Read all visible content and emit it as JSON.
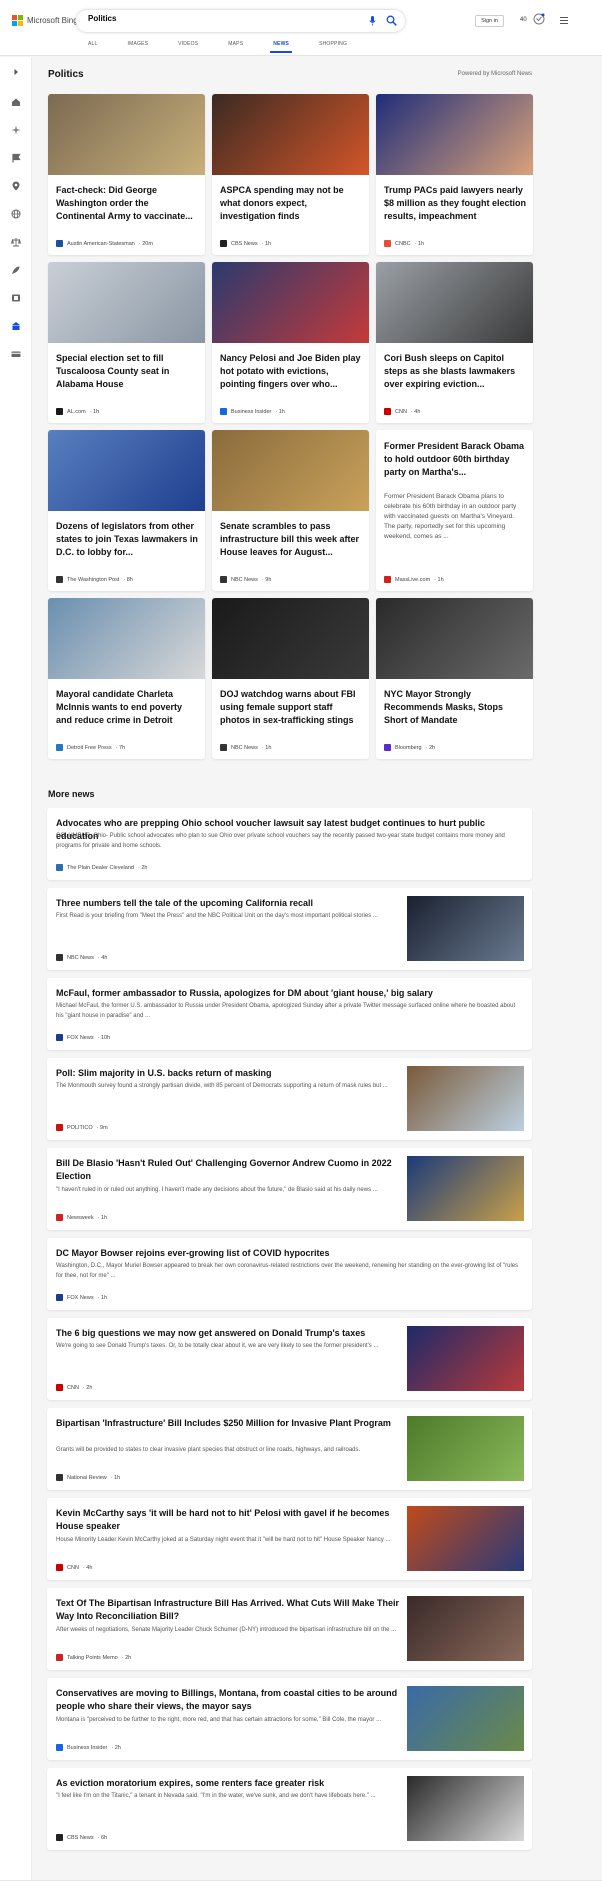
{
  "header": {
    "brand": "Microsoft Bing",
    "query": "Politics",
    "signin_label": "Sign in",
    "points": "40",
    "brand_colors": [
      "#f25022",
      "#7fba00",
      "#00a4ef",
      "#ffb900"
    ],
    "accent": "#174ae4"
  },
  "tabs": [
    {
      "label": "ALL"
    },
    {
      "label": "IMAGES"
    },
    {
      "label": "VIDEOS"
    },
    {
      "label": "MAPS"
    },
    {
      "label": "NEWS"
    },
    {
      "label": "SHOPPING"
    }
  ],
  "active_tab": "NEWS",
  "section": {
    "title": "Politics",
    "powered": "Powered by Microsoft News"
  },
  "cards": [
    {
      "title": "Fact-check: Did George Washington order the Continental Army to vaccinate...",
      "source": "Austin American-Statesman",
      "time": "· 20m",
      "img_colors": [
        "#7c6a52",
        "#c7b07a"
      ],
      "logo_color": "#1c4fa0"
    },
    {
      "title": "ASPCA spending may not be what donors expect, investigation finds",
      "source": "CBS News",
      "time": "· 1h",
      "img_colors": [
        "#3b2a22",
        "#d3562a"
      ],
      "logo_color": "#222222"
    },
    {
      "title": "Trump PACs paid lawyers nearly $8 million as they fought election results, impeachment",
      "source": "CNBC",
      "time": "· 1h",
      "img_colors": [
        "#1f2d7a",
        "#d9a27a"
      ],
      "logo_color": "#e84c3d"
    },
    {
      "title": "Special election set to fill Tuscaloosa County seat in Alabama House",
      "source": "AL.com",
      "time": "· 1h",
      "img_colors": [
        "#c9cfd6",
        "#8a96a3"
      ],
      "logo_color": "#1a1a1a"
    },
    {
      "title": "Nancy Pelosi and Joe Biden play hot potato with evictions, pointing fingers over who...",
      "source": "Business Insider",
      "time": "· 1h",
      "img_colors": [
        "#2a3a6e",
        "#c43a3a"
      ],
      "logo_color": "#1466e6"
    },
    {
      "title": "Cori Bush sleeps on Capitol steps as she blasts lawmakers over expiring eviction...",
      "source": "CNN",
      "time": "· 4h",
      "img_colors": [
        "#9aa0a6",
        "#3a3a3a"
      ],
      "logo_color": "#cc0000"
    },
    {
      "title": "Dozens of legislators from other states to join Texas lawmakers in D.C. to lobby for...",
      "source": "The Washington Post",
      "time": "· 8h",
      "img_colors": [
        "#5a7fbf",
        "#1e3f8f"
      ],
      "logo_color": "#333333"
    },
    {
      "title": "Senate scrambles to pass infrastructure bill this week after House leaves for August...",
      "source": "NBC News",
      "time": "· 9h",
      "img_colors": [
        "#8a6b3d",
        "#c9a25a"
      ],
      "logo_color": "#333333"
    },
    {
      "title": "Former President Barack Obama to hold outdoor 60th birthday party on Martha's...",
      "source": "MassLive.com",
      "time": "· 1h",
      "snippet": "Former President Barack Obama plans to celebrate his 60th birthday in an outdoor party with vaccinated guests on Martha's Vineyard. The party, reportedly set for this upcoming weekend, comes as ...",
      "logo_color": "#cc2222"
    },
    {
      "title": "Mayoral candidate Charleta McInnis wants to end poverty and reduce crime in Detroit",
      "source": "Detroit Free Press",
      "time": "· 7h",
      "img_colors": [
        "#6a8fb0",
        "#d8d8d8"
      ],
      "logo_color": "#2277cc"
    },
    {
      "title": "DOJ watchdog warns about FBI using female support staff photos in sex-trafficking stings",
      "source": "NBC News",
      "time": "· 1h",
      "img_colors": [
        "#1a1a1a",
        "#3a3a3a"
      ],
      "logo_color": "#333333"
    },
    {
      "title": "NYC Mayor Strongly Recommends Masks, Stops Short of Mandate",
      "source": "Bloomberg",
      "time": "· 2h",
      "img_colors": [
        "#2a2a2a",
        "#6a6a6a"
      ],
      "logo_color": "#5a2bc8"
    }
  ],
  "more_news": {
    "title": "More news",
    "items": [
      {
        "title": "Advocates who are prepping Ohio school voucher lawsuit say latest budget continues to hurt public education",
        "snippet": "COLUMBUS, Ohio- Public school advocates who plan to sue Ohio over private school vouchers say the recently passed two-year state budget contains more money and programs for private and home schools.",
        "source": "The Plain Dealer Cleveland",
        "time": "· 2h",
        "logo_color": "#2c6cb0"
      },
      {
        "title": "Three numbers tell the tale of the upcoming California recall",
        "snippet": "First Read is your briefing from \"Meet the Press\" and the NBC Political Unit on the day's most important political stories ...",
        "source": "NBC News",
        "time": "· 4h",
        "img_colors": [
          "#1a2130",
          "#6a7a90"
        ],
        "logo_color": "#333333"
      },
      {
        "title": "McFaul, former ambassador to Russia, apologizes for DM about 'giant house,' big salary",
        "snippet": "Michael McFaul, the former U.S. ambassador to Russia under President Obama, apologized Sunday after a private Twitter message surfaced online where he boasted about his \"giant house in paradise\" and ...",
        "source": "FOX News",
        "time": "· 10h",
        "logo_color": "#1d3c8f"
      },
      {
        "title": "Poll: Slim majority in U.S. backs return of masking",
        "snippet": "The Monmouth survey found a strongly partisan divide, with 85 percent of Democrats supporting a return of mask rules but ...",
        "source": "POLITICO",
        "time": "· 9m",
        "img_colors": [
          "#7a5a3a",
          "#bcd0e0"
        ],
        "logo_color": "#cc1111"
      },
      {
        "title": "Bill De Blasio 'Hasn't Ruled Out' Challenging Governor Andrew Cuomo in 2022 Election",
        "snippet": "\"I haven't ruled in or ruled out anything. I haven't made any decisions about the future,\" de Blasio said at his daily news ...",
        "source": "Newsweek",
        "time": "· 1h",
        "img_colors": [
          "#1b3a7a",
          "#c9a04a"
        ],
        "logo_color": "#d22222"
      },
      {
        "title": "DC Mayor Bowser rejoins ever-growing list of COVID hypocrites",
        "snippet": "Washington, D.C., Mayor Muriel Bowser appeared to break her own coronavirus-related restrictions over the weekend, renewing her standing on the ever-growing list of \"rules for thee, not for me\" ...",
        "source": "FOX News",
        "time": "· 1h",
        "logo_color": "#1d3c8f"
      },
      {
        "title": "The 6 big questions we may now get answered on Donald Trump's taxes",
        "snippet": "We're going to see Donald Trump's taxes. Or, to be totally clear about it, we are very likely to see the former president's ...",
        "source": "CNN",
        "time": "· 2h",
        "img_colors": [
          "#1e2a6a",
          "#b83a3a"
        ],
        "logo_color": "#cc0000"
      },
      {
        "title": "Bipartisan 'Infrastructure' Bill Includes $250 Million for Invasive Plant Program",
        "snippet": "Grants will be provided to states to clear invasive plant species that obstruct or line roads, highways, and railroads.",
        "source": "National Review",
        "time": "· 1h",
        "img_colors": [
          "#4d7a2a",
          "#8ab85a"
        ],
        "logo_color": "#333333"
      },
      {
        "title": "Kevin McCarthy says 'it will be hard not to hit' Pelosi with gavel if he becomes House speaker",
        "snippet": "House Minority Leader Kevin McCarthy joked at a Saturday night event that it \"will be hard not to hit\" House Speaker Nancy ...",
        "source": "CNN",
        "time": "· 4h",
        "img_colors": [
          "#c04a1a",
          "#2a3a7a"
        ],
        "logo_color": "#cc0000"
      },
      {
        "title": "Text Of The Bipartisan Infrastructure Bill Has Arrived. What Cuts Will Make Their Way Into Reconciliation Bill?",
        "snippet": "After weeks of negotiations, Senate Majority Leader Chuck Schumer (D-NY) introduced the bipartisan infrastructure bill on the ...",
        "source": "Talking Points Memo",
        "time": "· 2h",
        "img_colors": [
          "#3a2a2a",
          "#8a6a5a"
        ],
        "logo_color": "#cc2222"
      },
      {
        "title": "Conservatives are moving to Billings, Montana, from coastal cities to be around people who share their views, the mayor says",
        "snippet": "Montana is \"perceived to be further to the right, more red, and that has certain attractions for some,\" Bill Cole, the mayor ...",
        "source": "Business Insider",
        "time": "· 2h",
        "img_colors": [
          "#3a6aa8",
          "#6a8a4a"
        ],
        "logo_color": "#1466e6"
      },
      {
        "title": "As eviction moratorium expires, some renters face greater risk",
        "snippet": "\"I feel like I'm on the Titanic,\" a tenant in Nevada said. \"I'm in the water, we've sunk, and we don't have lifeboats here.\" ...",
        "source": "CBS News",
        "time": "· 6h",
        "img_colors": [
          "#2a2a2a",
          "#d8d8d8"
        ],
        "logo_color": "#222222"
      }
    ]
  }
}
